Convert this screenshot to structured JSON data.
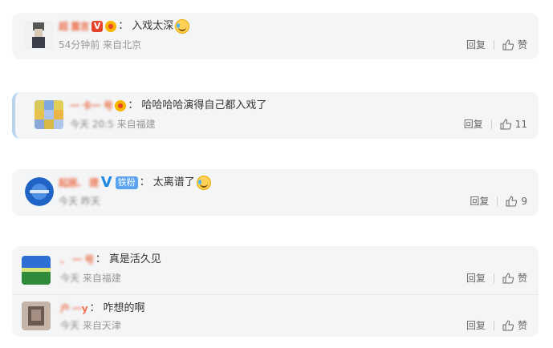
{
  "actions": {
    "reply_label": "回复",
    "like_label": "赞"
  },
  "comments": [
    {
      "name": "超 重言",
      "text": "入戏太深",
      "time": "54分钟前",
      "location": "来自北京",
      "likes": "赞"
    },
    {
      "name": "一 卡一 号",
      "text": "哈哈哈哈演得自己都入戏了",
      "time": "今天 20:5",
      "location": "来自福建",
      "likes": "11"
    },
    {
      "name": "起居、 提",
      "badge_fan": "铁粉",
      "text": "太离谱了",
      "time": "今天 昨天",
      "location": "",
      "likes": "9"
    },
    {
      "name": "、 一 号",
      "text": "真是活久见",
      "time": "今天",
      "location": "来自福建",
      "likes": "赞"
    },
    {
      "name": "户 一",
      "name_suffix": "y",
      "text": "咋想的啊",
      "time": "今天",
      "location": "来自天津",
      "likes": "赞"
    }
  ]
}
